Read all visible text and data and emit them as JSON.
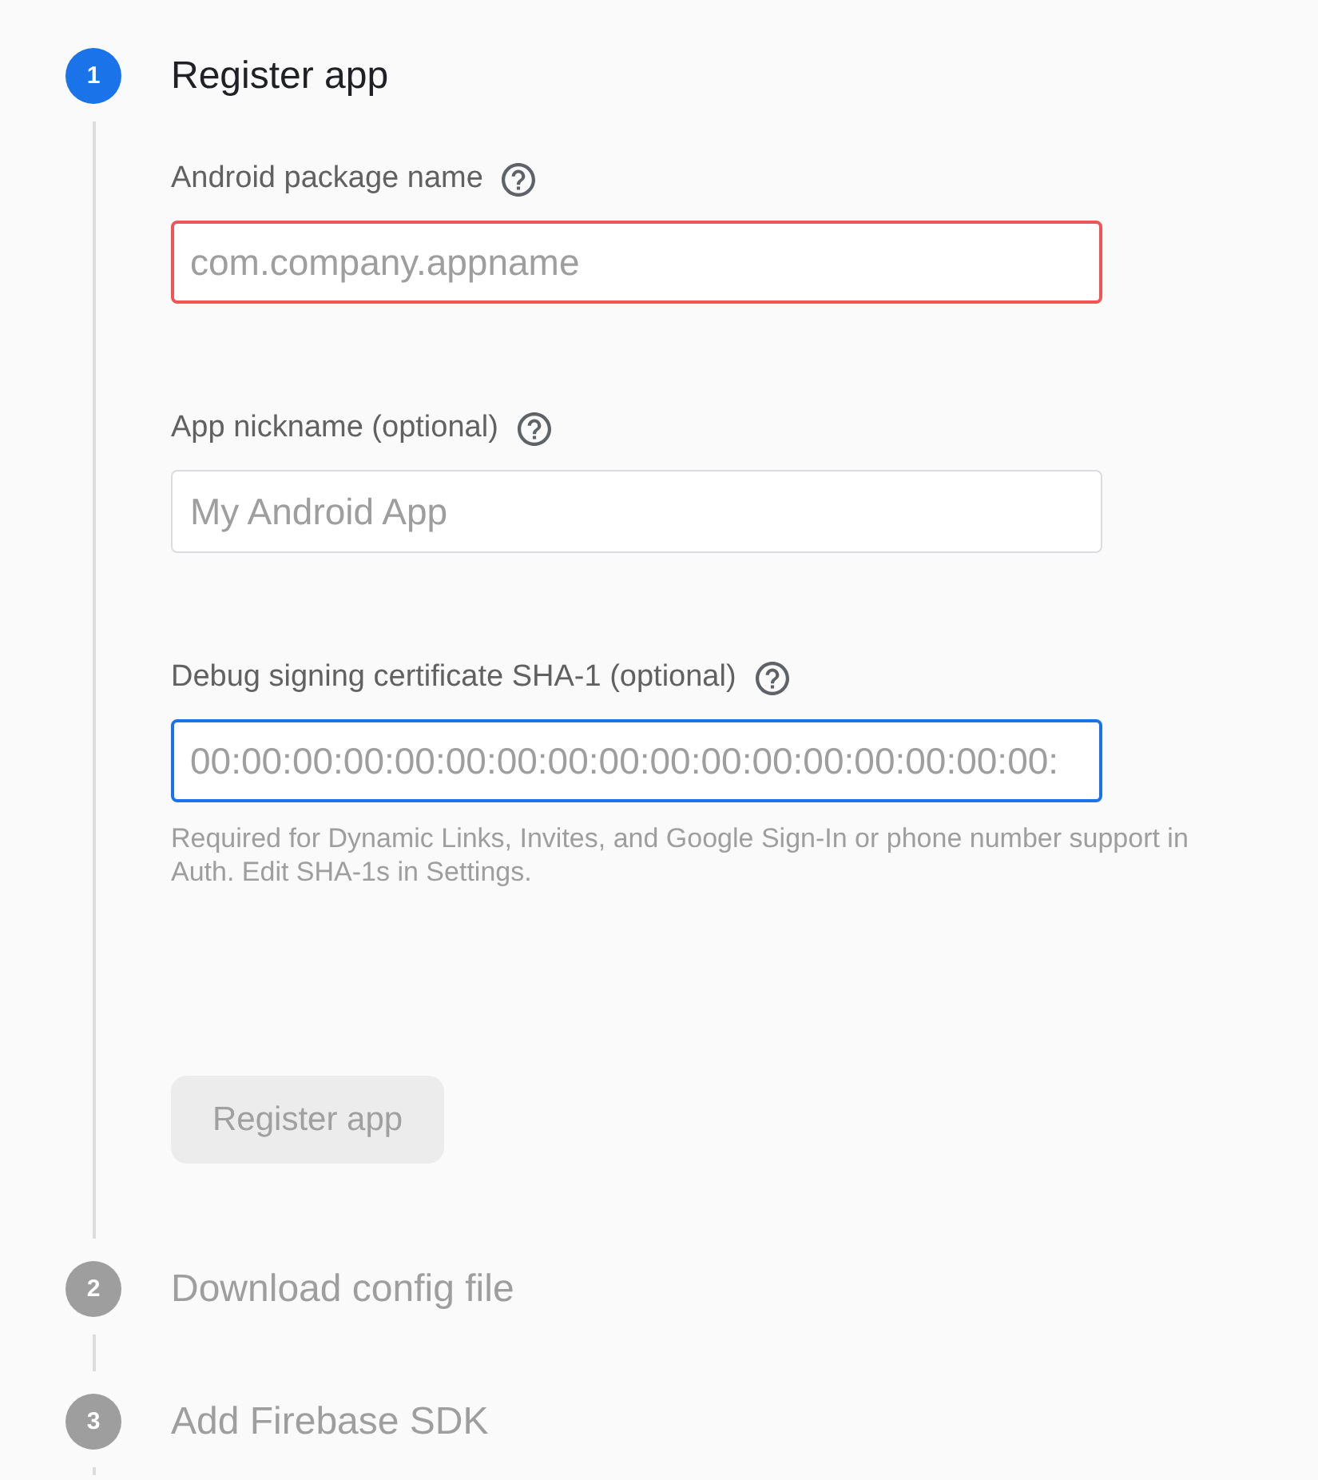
{
  "steps": [
    {
      "number": "1",
      "title": "Register app",
      "selected": true,
      "fields": [
        {
          "label": "Android package name",
          "placeholder": "com.company.appname",
          "error": true,
          "focused": false
        },
        {
          "label": "App nickname (optional)",
          "placeholder": "My Android App",
          "error": false,
          "focused": false
        },
        {
          "label": "Debug signing certificate SHA-1 (optional)",
          "placeholder": "00:00:00:00:00:00:00:00:00:00:00:00:00:00:00:00:00:",
          "error": false,
          "focused": true,
          "hint": "Required for Dynamic Links, Invites, and Google Sign-In or phone number support in Auth. Edit SHA-1s in Settings."
        }
      ],
      "button": {
        "label": "Register app",
        "disabled": true
      }
    },
    {
      "number": "2",
      "title": "Download config file",
      "selected": false
    },
    {
      "number": "3",
      "title": "Add Firebase SDK",
      "selected": false
    }
  ]
}
